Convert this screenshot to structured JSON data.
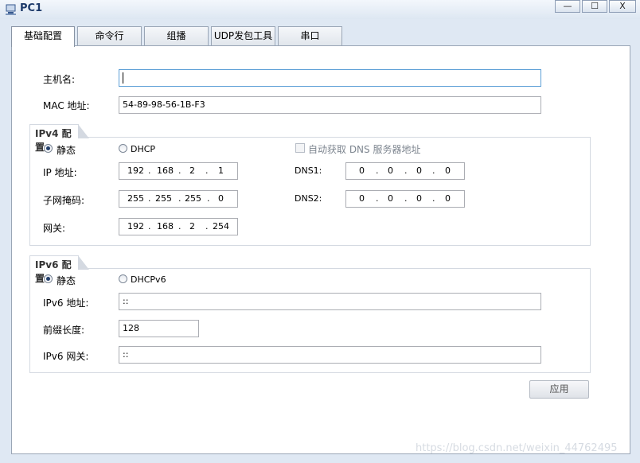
{
  "window": {
    "title": "PC1",
    "controls": {
      "minimize": "—",
      "maximize": "☐",
      "close": "X"
    }
  },
  "tabs": [
    {
      "label": "基础配置",
      "active": true
    },
    {
      "label": "命令行",
      "active": false
    },
    {
      "label": "组播",
      "active": false
    },
    {
      "label": "UDP发包工具",
      "active": false
    },
    {
      "label": "串口",
      "active": false
    }
  ],
  "basic": {
    "hostname_label": "主机名:",
    "hostname_value": "",
    "mac_label": "MAC 地址:",
    "mac_value": "54-89-98-56-1B-F3"
  },
  "ipv4": {
    "title": "IPv4 配置",
    "static_label": "静态",
    "dhcp_label": "DHCP",
    "auto_dns_label": "自动获取 DNS 服务器地址",
    "ip_label": "IP 地址:",
    "ip": [
      "192",
      "168",
      "2",
      "1"
    ],
    "mask_label": "子网掩码:",
    "mask": [
      "255",
      "255",
      "255",
      "0"
    ],
    "gateway_label": "网关:",
    "gateway": [
      "192",
      "168",
      "2",
      "254"
    ],
    "dns1_label": "DNS1:",
    "dns1": [
      "0",
      "0",
      "0",
      "0"
    ],
    "dns2_label": "DNS2:",
    "dns2": [
      "0",
      "0",
      "0",
      "0"
    ],
    "static_checked": true,
    "auto_dns_checked": false
  },
  "ipv6": {
    "title": "IPv6 配置",
    "static_label": "静态",
    "dhcp_label": "DHCPv6",
    "address_label": "IPv6 地址:",
    "address_value": "::",
    "prefix_label": "前缀长度:",
    "prefix_value": "128",
    "gateway_label": "IPv6 网关:",
    "gateway_value": "::",
    "static_checked": true
  },
  "apply_label": "应用",
  "watermark": "https://blog.csdn.net/weixin_44762495"
}
